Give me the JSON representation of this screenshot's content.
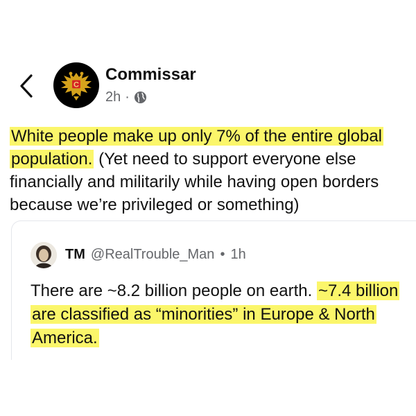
{
  "post": {
    "author_name": "Commissar",
    "time_ago": "2h",
    "separator": "·",
    "highlighted_text": "White people make up only 7% of the entire global population.",
    "body_text": " (Yet need to support everyone else financially and militarily while having open borders because we’re privileged or something)"
  },
  "quoted_post": {
    "author_name": "TM",
    "handle": "@RealTrouble_Man",
    "separator": "•",
    "time_ago": "1h",
    "text_start": "There are ~8.2 billion people on earth. ",
    "highlighted_text": "~7.4 billion are classified as “minorities” in Europe & North America."
  },
  "colors": {
    "highlight": "#fbf66a",
    "secondary_text": "#65676b",
    "avatar_badge": "#d62424"
  },
  "icons": [
    "chevron-left-icon",
    "globe-icon"
  ]
}
